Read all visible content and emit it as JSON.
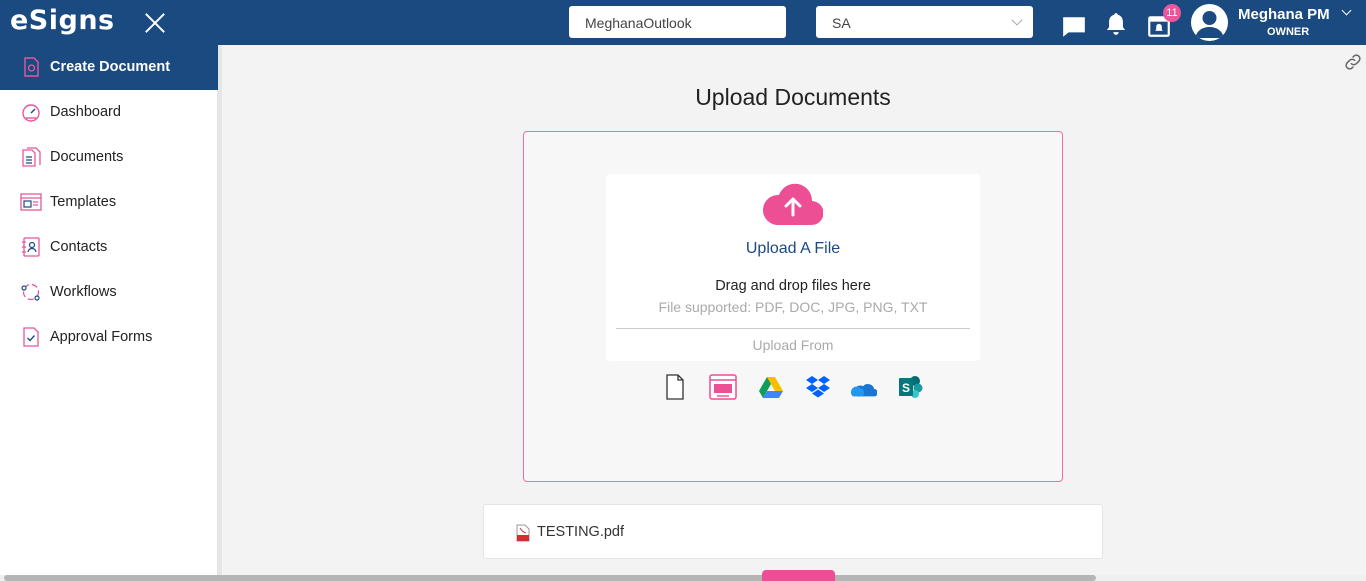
{
  "header": {
    "logo_text": "eSigns",
    "account_name": "MeghanaOutlook",
    "company_select": "SA",
    "notification_count": "11",
    "user_name": "Meghana PM",
    "user_role": "OWNER"
  },
  "sidebar": {
    "items": [
      {
        "label": "Create Document",
        "icon": "create-document-icon"
      },
      {
        "label": "Dashboard",
        "icon": "dashboard-icon"
      },
      {
        "label": "Documents",
        "icon": "documents-icon"
      },
      {
        "label": "Templates",
        "icon": "templates-icon"
      },
      {
        "label": "Contacts",
        "icon": "contacts-icon"
      },
      {
        "label": "Workflows",
        "icon": "workflows-icon"
      },
      {
        "label": "Approval Forms",
        "icon": "approval-forms-icon"
      }
    ]
  },
  "main": {
    "title": "Upload Documents",
    "upload_title": "Upload A File",
    "drag_text": "Drag and drop files here",
    "supported_text": "File supported: PDF, DOC, JPG, PNG, TXT",
    "upload_from": "Upload From",
    "sources": [
      "blank-file-icon",
      "template-source-icon",
      "google-drive-icon",
      "dropbox-icon",
      "onedrive-icon",
      "sharepoint-icon"
    ],
    "uploaded_file": "TESTING.pdf"
  },
  "colors": {
    "header_bg": "#1b4a80",
    "accent_pink": "#ec4f94"
  }
}
